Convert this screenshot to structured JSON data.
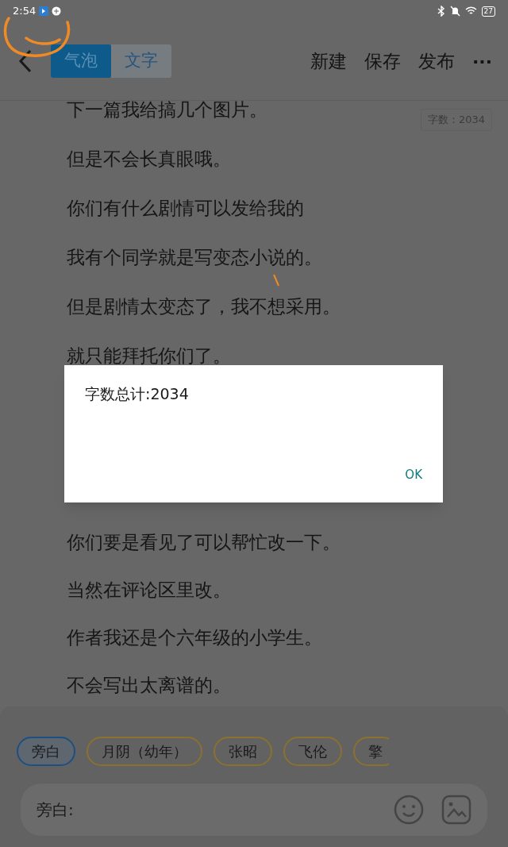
{
  "status_bar": {
    "time": "2:54",
    "battery": "27"
  },
  "toolbar": {
    "tabs": [
      {
        "label": "气泡",
        "selected": true
      },
      {
        "label": "文字",
        "selected": false
      }
    ],
    "actions": [
      "新建",
      "保存",
      "发布"
    ],
    "more": "···"
  },
  "word_count": "字数：2034",
  "lines_before": [
    "下一篇我给搞几个图片。",
    "但是不会长真眼哦。",
    "你们有什么剧情可以发给我的",
    "我有个同学就是写变态小说的。",
    "但是剧情太变态了，我不想采用。",
    "就只能拜托你们了。"
  ],
  "lines_after": [
    "你们要是看见了可以帮忙改一下。",
    "当然在评论区里改。",
    "作者我还是个六年级的小学生。",
    "不会写出太离谱的。"
  ],
  "dialog": {
    "message": "字数总计:2034",
    "button": "OK"
  },
  "characters": [
    {
      "label": "旁白",
      "selected": true
    },
    {
      "label": "月阴（幼年）",
      "selected": false
    },
    {
      "label": "张昭",
      "selected": false
    },
    {
      "label": "飞伦",
      "selected": false
    },
    {
      "label": "擎",
      "selected": false
    }
  ],
  "input": {
    "placeholder": "旁白:"
  }
}
